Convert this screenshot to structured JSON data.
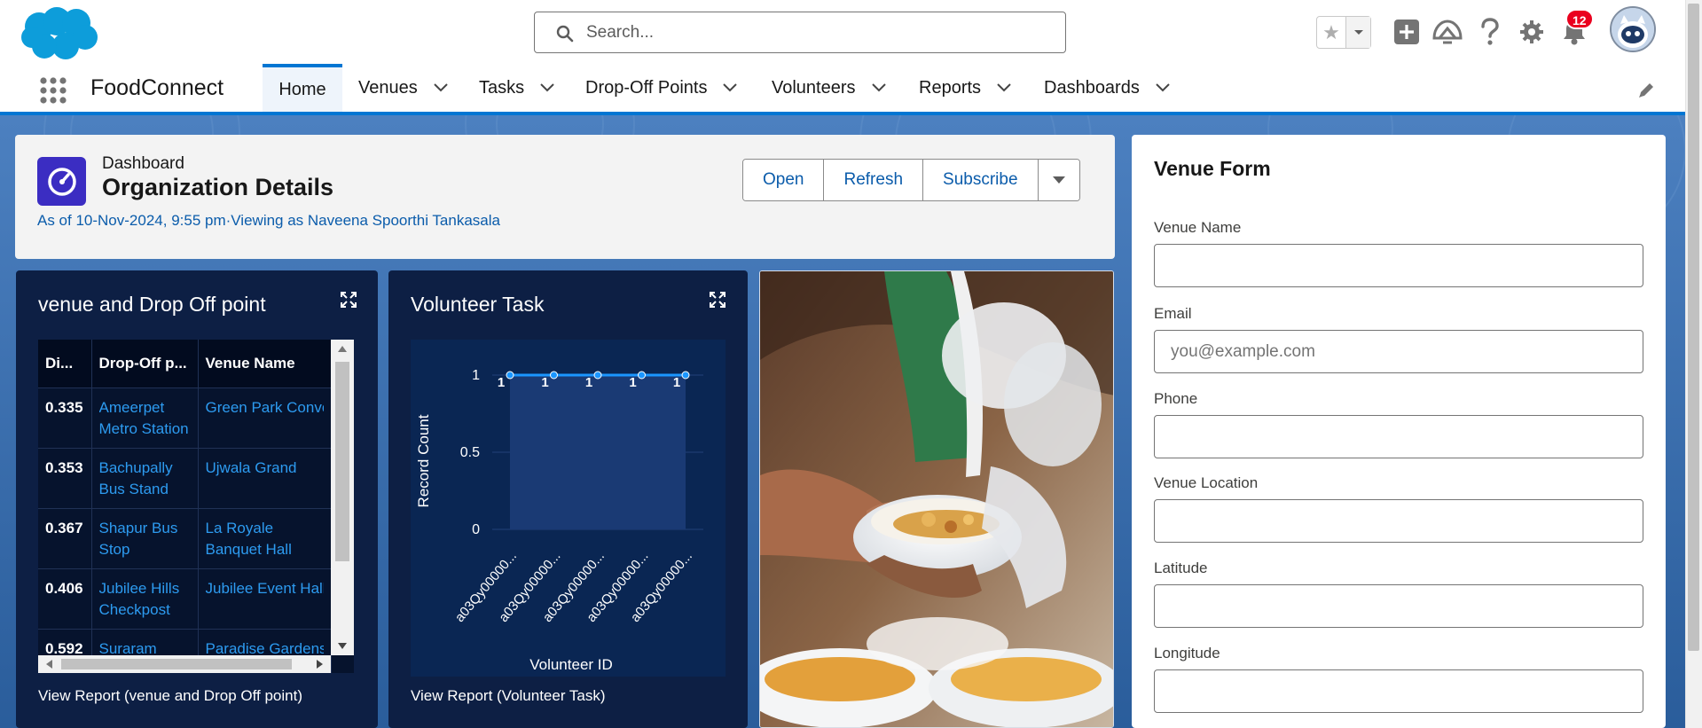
{
  "header": {
    "search_placeholder": "Search...",
    "notification_count": "12"
  },
  "nav": {
    "app_name": "FoodConnect",
    "tabs": [
      {
        "label": "Home"
      },
      {
        "label": "Venues"
      },
      {
        "label": "Tasks"
      },
      {
        "label": "Drop-Off Points"
      },
      {
        "label": "Volunteers"
      },
      {
        "label": "Reports"
      },
      {
        "label": "Dashboards"
      }
    ]
  },
  "dashboard": {
    "label": "Dashboard",
    "title": "Organization Details",
    "subtitle": "As of 10-Nov-2024, 9:55 pm·Viewing as Naveena Spoorthi Tankasala",
    "buttons": {
      "open": "Open",
      "refresh": "Refresh",
      "subscribe": "Subscribe"
    }
  },
  "venue_panel": {
    "title": "venue and Drop Off point",
    "columns": [
      "Di...",
      "Drop-Off p...",
      "Venue Name"
    ],
    "rows": [
      {
        "distance": "0.335",
        "dropoff": "Ameerpet Metro Station",
        "venue": "Green Park Convention Center"
      },
      {
        "distance": "0.353",
        "dropoff": "Bachupally Bus Stand",
        "venue": "Ujwala Grand"
      },
      {
        "distance": "0.367",
        "dropoff": "Shapur Bus Stop",
        "venue": "La Royale Banquet Hall"
      },
      {
        "distance": "0.406",
        "dropoff": "Jubilee Hills Checkpost",
        "venue": "Jubilee Event Hall"
      },
      {
        "distance": "0.592",
        "dropoff": "Suraram",
        "venue": "Paradise Gardens"
      }
    ],
    "link": "View Report (venue and Drop Off point)"
  },
  "task_panel": {
    "title": "Volunteer Task",
    "link": "View Report (Volunteer Task)"
  },
  "chart_data": {
    "type": "area",
    "title": "Volunteer Task",
    "xlabel": "Volunteer ID",
    "ylabel": "Record Count",
    "categories": [
      "a03Qy00000...",
      "a03Qy00000...",
      "a03Qy00000...",
      "a03Qy00000...",
      "a03Qy00000..."
    ],
    "values": [
      1,
      1,
      1,
      1,
      1
    ],
    "yticks": [
      "0",
      "0.5",
      "1"
    ],
    "ylim": [
      0,
      1
    ],
    "grid": true,
    "colors": {
      "line": "#1b96ff",
      "fill": "#1a3a74"
    }
  },
  "venue_form": {
    "title": "Venue Form",
    "fields": [
      {
        "label": "Venue Name",
        "placeholder": ""
      },
      {
        "label": "Email",
        "placeholder": "you@example.com"
      },
      {
        "label": "Phone",
        "placeholder": ""
      },
      {
        "label": "Venue Location",
        "placeholder": ""
      },
      {
        "label": "Latitude",
        "placeholder": ""
      },
      {
        "label": "Longitude",
        "placeholder": ""
      }
    ]
  },
  "colors": {
    "brand": "#0176d3",
    "panel": "#0d1f44",
    "link": "#0b5cab"
  }
}
